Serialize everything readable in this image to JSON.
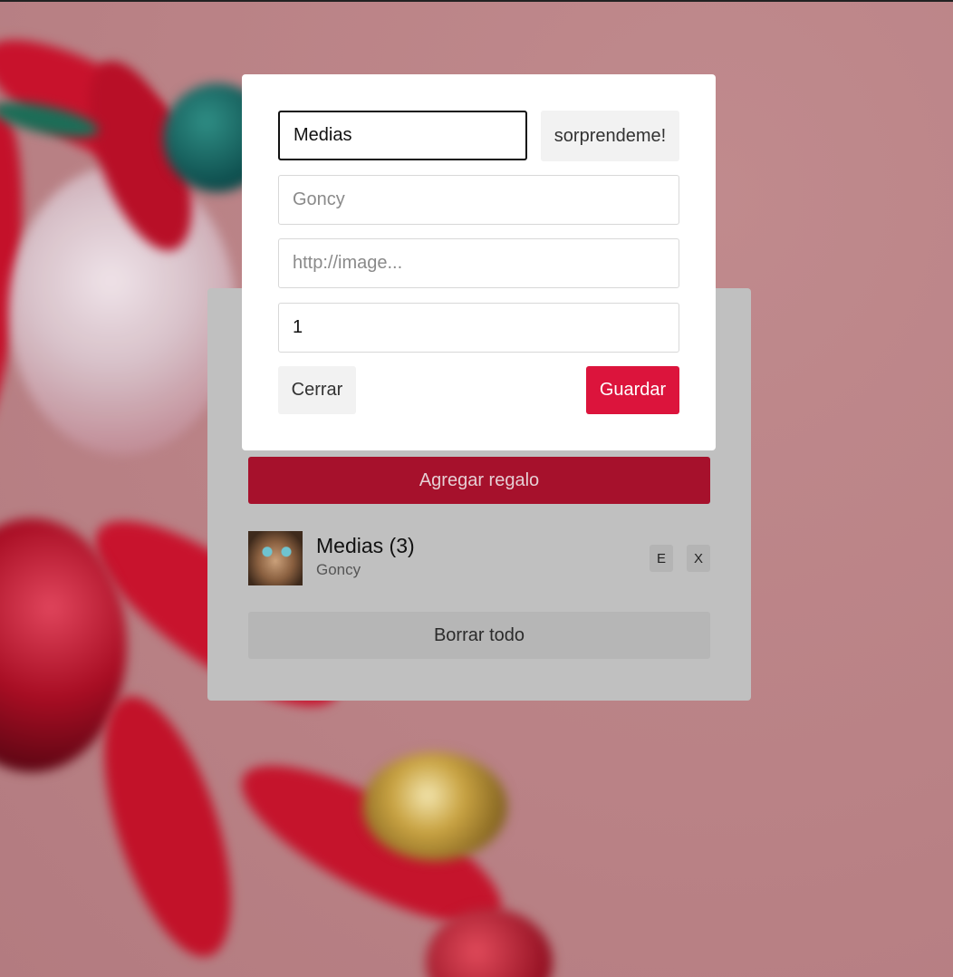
{
  "theme": {
    "accent": "#dc143c",
    "add_button_color": "#a6112c",
    "panel_color": "#c0c0c0",
    "background_color": "#c08488"
  },
  "modal": {
    "name_input": {
      "value": "Medias",
      "placeholder": ""
    },
    "surprise_label": "sorprendeme!",
    "owner_input": {
      "value": "",
      "placeholder": "Goncy"
    },
    "image_input": {
      "value": "",
      "placeholder": "http://image..."
    },
    "quantity_input": {
      "value": "1"
    },
    "close_label": "Cerrar",
    "save_label": "Guardar"
  },
  "panel": {
    "add_label": "Agregar regalo",
    "gifts": [
      {
        "name": "Medias (3)",
        "owner": "Goncy",
        "image_icon": "cat-photo",
        "edit_label": "E",
        "delete_label": "X"
      }
    ],
    "clear_label": "Borrar todo"
  }
}
